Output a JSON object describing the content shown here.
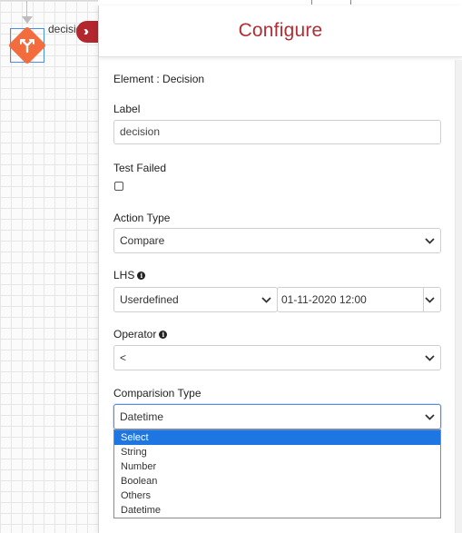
{
  "canvas": {
    "node_label": "decision"
  },
  "panel": {
    "title": "Configure",
    "element_line": "Element : Decision",
    "label_field": {
      "title": "Label",
      "value": "decision"
    },
    "test_failed": {
      "title": "Test Failed",
      "checked": false
    },
    "action_type": {
      "title": "Action Type",
      "value": "Compare"
    },
    "lhs": {
      "title": "LHS",
      "type_value": "Userdefined",
      "date_value": "01-11-2020 12:00"
    },
    "operator": {
      "title": "Operator",
      "value": "<"
    },
    "comparison_type": {
      "title": "Comparision Type",
      "value": "Datetime",
      "options": [
        "Select",
        "String",
        "Number",
        "Boolean",
        "Others",
        "Datetime"
      ],
      "highlighted": "Select"
    }
  },
  "colors": {
    "brand_red": "#b02e34",
    "node_orange": "#f36c3d",
    "highlight_blue": "#1e76e3"
  },
  "icons": {
    "collapse": "double-chevron-right-icon",
    "node": "decision-diamond-icon",
    "info": "info-icon",
    "dropdown": "chevron-down-icon"
  }
}
